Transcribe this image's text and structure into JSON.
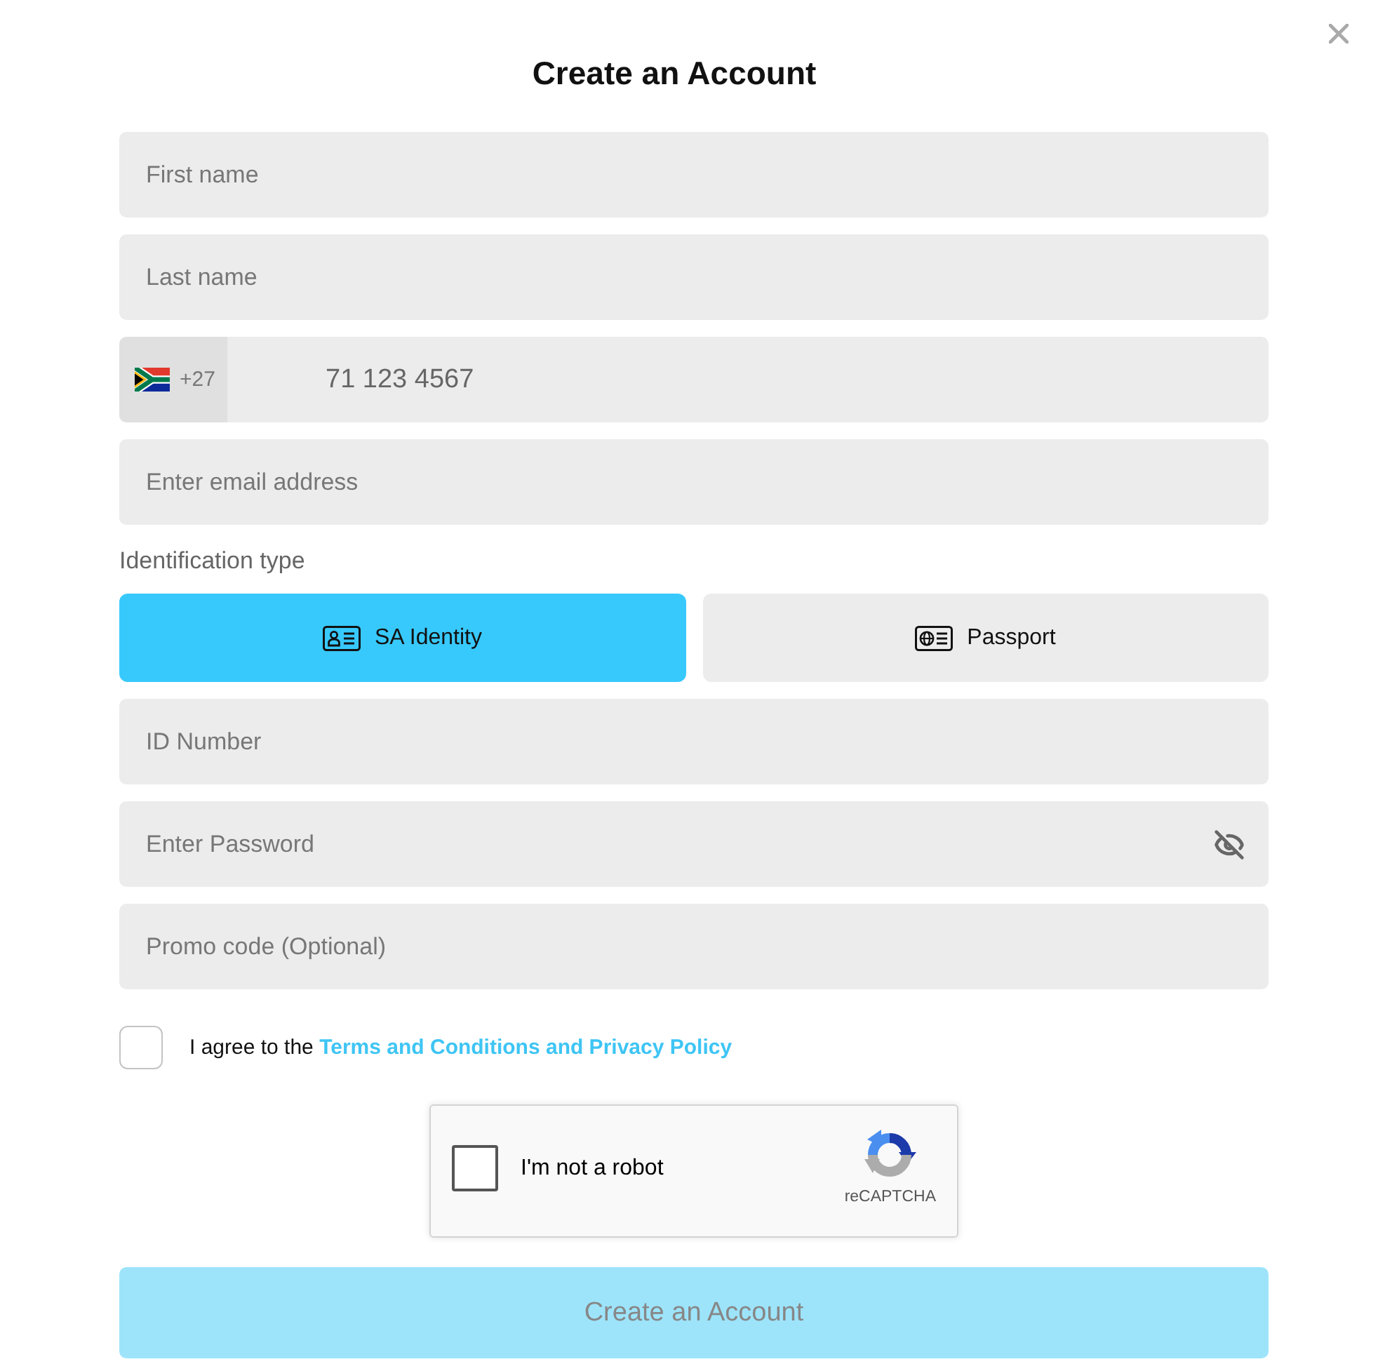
{
  "dialog": {
    "title": "Create an Account"
  },
  "contact_fields": [
    {
      "kind": "text",
      "placeholder": "First name"
    },
    {
      "kind": "text",
      "placeholder": "Last name"
    },
    {
      "kind": "phone",
      "country_code": "+27",
      "placeholder": "71 123 4567"
    },
    {
      "kind": "text",
      "placeholder": "Enter email address"
    }
  ],
  "identification": {
    "label": "Identification type",
    "options": [
      {
        "kind": "id-card",
        "label": "SA Identity",
        "selected": true
      },
      {
        "kind": "passport",
        "label": "Passport",
        "selected": false
      }
    ]
  },
  "account_fields": [
    {
      "kind": "text",
      "placeholder": "ID Number"
    },
    {
      "kind": "password",
      "placeholder": "Enter Password"
    },
    {
      "kind": "text",
      "placeholder": "Promo code (Optional)"
    }
  ],
  "agreement": {
    "checked": false,
    "text": "I agree to the",
    "link": "Terms and Conditions and Privacy Policy"
  },
  "captcha": {
    "checked": false,
    "label": "I'm not a robot",
    "brand": "reCAPTCHA"
  },
  "submit": {
    "label": "Create an Account",
    "disabled": true
  }
}
